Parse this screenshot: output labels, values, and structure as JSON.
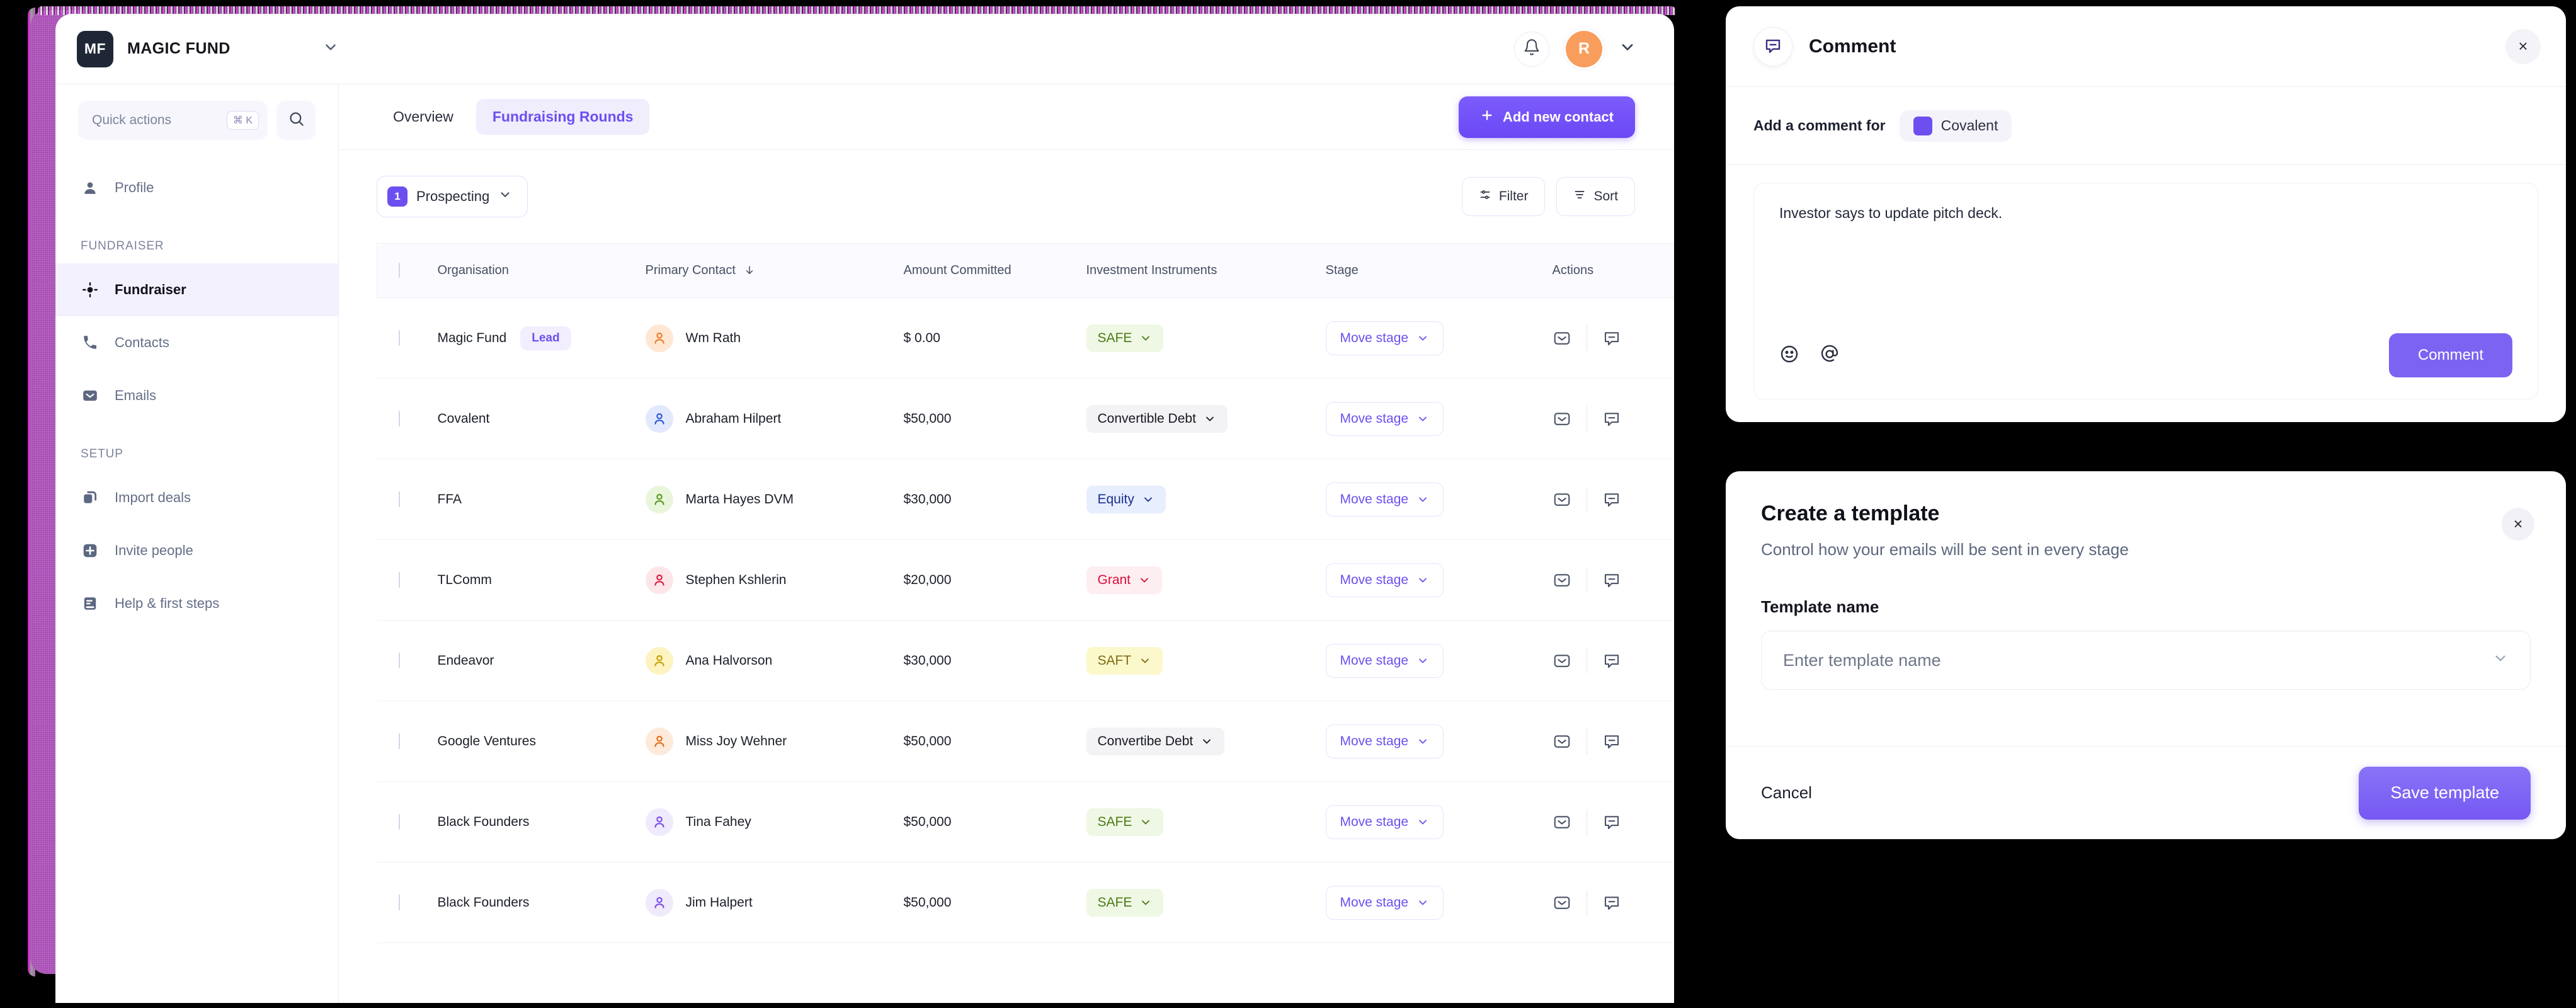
{
  "app": {
    "brand_initials": "MF",
    "brand_name": "MAGIC FUND",
    "avatar_initial": "R"
  },
  "sidebar": {
    "quick_actions_placeholder": "Quick actions",
    "shortcut": "⌘ K",
    "items_top": [
      {
        "label": "Profile",
        "icon": "person-icon",
        "active": false
      }
    ],
    "section_fundraiser": "FUNDRAISER",
    "items_fundraiser": [
      {
        "label": "Fundraiser",
        "icon": "target-icon",
        "active": true
      },
      {
        "label": "Contacts",
        "icon": "phone-icon",
        "active": false
      },
      {
        "label": "Emails",
        "icon": "envelope-icon",
        "active": false
      }
    ],
    "section_setup": "SETUP",
    "items_setup": [
      {
        "label": "Import deals",
        "icon": "copy-icon",
        "active": false
      },
      {
        "label": "Invite people",
        "icon": "plus-square-icon",
        "active": false
      },
      {
        "label": "Help & first steps",
        "icon": "book-icon",
        "active": false
      }
    ]
  },
  "main": {
    "tabs": [
      {
        "label": "Overview",
        "active": false
      },
      {
        "label": "Fundraising Rounds",
        "active": true
      }
    ],
    "add_contact_label": "Add new contact",
    "stage_filter": {
      "count": "1",
      "label": "Prospecting"
    },
    "filter_label": "Filter",
    "sort_label": "Sort",
    "table": {
      "columns": [
        "Organisation",
        "Primary Contact",
        "Amount Committed",
        "Investment Instruments",
        "Stage",
        "Actions"
      ],
      "sorted_column": "Primary Contact",
      "sort_direction": "desc",
      "move_stage_label": "Move stage",
      "rows": [
        {
          "organisation": "Magic Fund",
          "tag": "Lead",
          "contact": "Wm Rath",
          "avatar_color": "#ffe7d4",
          "avatar_fg": "#f07b2a",
          "amount": "$ 0.00",
          "instrument": "SAFE",
          "instrument_bg": "#eef8e4",
          "instrument_fg": "#4c7a15"
        },
        {
          "organisation": "Covalent",
          "tag": "",
          "contact": "Abraham Hilpert",
          "avatar_color": "#e3e9fd",
          "avatar_fg": "#2f58d8",
          "amount": "$50,000",
          "instrument": "Convertible Debt",
          "instrument_bg": "#f3f3f6",
          "instrument_fg": "#16181f"
        },
        {
          "organisation": "FFA",
          "tag": "",
          "contact": "Marta Hayes DVM",
          "avatar_color": "#e9f6dc",
          "avatar_fg": "#5c9b23",
          "amount": "$30,000",
          "instrument": "Equity",
          "instrument_bg": "#e7eefd",
          "instrument_fg": "#1b2f8c"
        },
        {
          "organisation": "TLComm",
          "tag": "",
          "contact": "Stephen Kshlerin",
          "avatar_color": "#fde6ea",
          "avatar_fg": "#e02040",
          "amount": "$20,000",
          "instrument": "Grant",
          "instrument_bg": "#fdeef1",
          "instrument_fg": "#dc0b3a"
        },
        {
          "organisation": "Endeavor",
          "tag": "",
          "contact": "Ana Halvorson",
          "avatar_color": "#fcf3c0",
          "avatar_fg": "#c9a106",
          "amount": "$30,000",
          "instrument": "SAFT",
          "instrument_bg": "#fbf8cc",
          "instrument_fg": "#7e6a12"
        },
        {
          "organisation": "Google Ventures",
          "tag": "",
          "contact": "Miss Joy Wehner",
          "avatar_color": "#fdeada",
          "avatar_fg": "#e2701d",
          "amount": "$50,000",
          "instrument": "Convertibe Debt",
          "instrument_bg": "#f3f3f6",
          "instrument_fg": "#16181f"
        },
        {
          "organisation": "Black Founders",
          "tag": "",
          "contact": "Tina Fahey",
          "avatar_color": "#f0eafd",
          "avatar_fg": "#7b4fe8",
          "amount": "$50,000",
          "instrument": "SAFE",
          "instrument_bg": "#eef8e4",
          "instrument_fg": "#4c7a15"
        },
        {
          "organisation": "Black Founders",
          "tag": "",
          "contact": "Jim Halpert",
          "avatar_color": "#f0eafd",
          "avatar_fg": "#7b4fe8",
          "amount": "$50,000",
          "instrument": "SAFE",
          "instrument_bg": "#eef8e4",
          "instrument_fg": "#4c7a15"
        }
      ]
    }
  },
  "comment_panel": {
    "title": "Comment",
    "close_label": "×",
    "subtitle": "Add a comment for",
    "org_chip": "Covalent",
    "text": "Investor says to update pitch deck.",
    "submit_label": "Comment"
  },
  "template_modal": {
    "title": "Create a template",
    "subtitle": "Control how your emails will be sent in every stage",
    "close_label": "×",
    "field_label": "Template name",
    "field_placeholder": "Enter template name",
    "cancel_label": "Cancel",
    "save_label": "Save template"
  },
  "colors": {
    "accent": "#6d4ff0",
    "accent_light": "#f0edfd",
    "avatar": "#f99d5d"
  }
}
